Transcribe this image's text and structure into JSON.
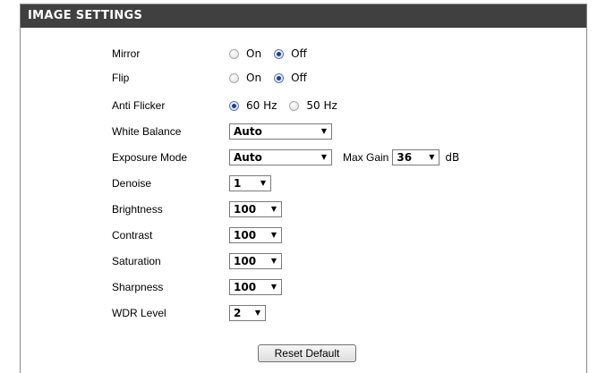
{
  "section": {
    "title": "IMAGE SETTINGS"
  },
  "rows": {
    "mirror": {
      "label": "Mirror",
      "on": "On",
      "off": "Off",
      "selected": "Off"
    },
    "flip": {
      "label": "Flip",
      "on": "On",
      "off": "Off",
      "selected": "Off"
    },
    "anti_flicker": {
      "label": "Anti Flicker",
      "opt1": "60 Hz",
      "opt2": "50 Hz",
      "selected": "60 Hz"
    },
    "white_balance": {
      "label": "White Balance",
      "value": "Auto"
    },
    "exposure_mode": {
      "label": "Exposure Mode",
      "value": "Auto",
      "max_gain_label": "Max Gain",
      "max_gain_value": "36",
      "unit": "dB"
    },
    "denoise": {
      "label": "Denoise",
      "value": "1"
    },
    "brightness": {
      "label": "Brightness",
      "value": "100"
    },
    "contrast": {
      "label": "Contrast",
      "value": "100"
    },
    "saturation": {
      "label": "Saturation",
      "value": "100"
    },
    "sharpness": {
      "label": "Sharpness",
      "value": "100"
    },
    "wdr_level": {
      "label": "WDR Level",
      "value": "2"
    }
  },
  "buttons": {
    "reset_default": "Reset Default"
  },
  "icons": {
    "dropdown": "caret-down-icon",
    "radio_on": "radio-checked-icon",
    "radio_off": "radio-unchecked-icon"
  }
}
